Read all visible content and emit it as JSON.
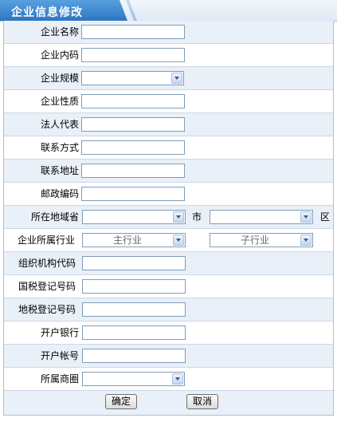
{
  "header": {
    "title": "企业信息修改"
  },
  "fields": {
    "name": "企业名称",
    "code": "企业内码",
    "scale": "企业规模",
    "nature": "企业性质",
    "legal": "法人代表",
    "contact": "联系方式",
    "address": "联系地址",
    "zip": "邮政编码",
    "region": "所在地域省",
    "city": "市",
    "district": "区",
    "industry": "企业所属行业",
    "industry_main": "主行业",
    "industry_sub": "子行业",
    "org_code": "组织机构代码",
    "national_tax": "国税登记号码",
    "local_tax": "地税登记号码",
    "bank": "开户银行",
    "account": "开户帐号",
    "business_circle": "所属商圈"
  },
  "buttons": {
    "confirm": "确定",
    "cancel": "取消"
  }
}
